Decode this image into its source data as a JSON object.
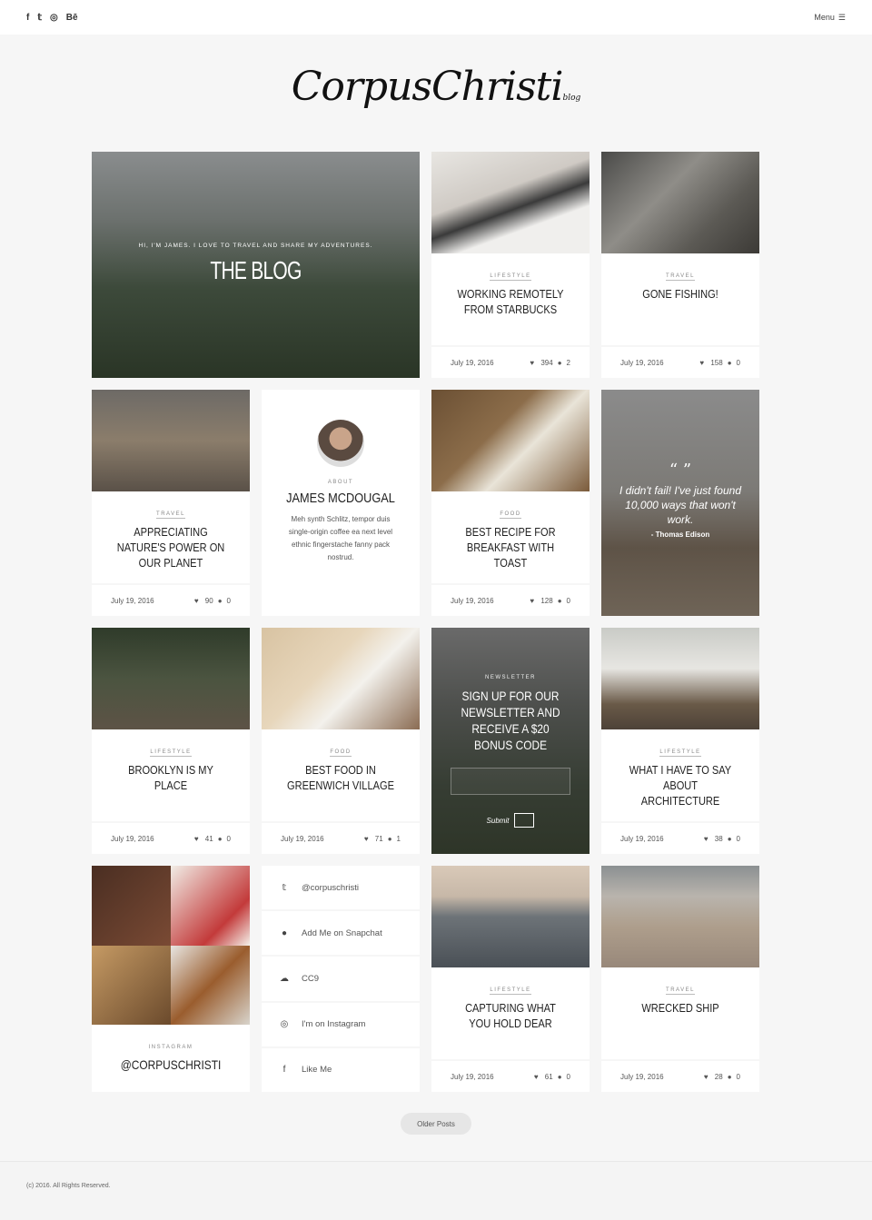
{
  "topbar": {
    "socials": [
      "f",
      "𝕥",
      "◎",
      "Bē"
    ],
    "menu_label": "Menu"
  },
  "logo": {
    "text": "CorpusChristi",
    "sub": "blog"
  },
  "hero": {
    "subtitle": "HI, I'M JAMES. I LOVE TO TRAVEL AND SHARE MY ADVENTURES.",
    "title": "THE BLOG"
  },
  "posts": [
    {
      "category": "LIFESTYLE",
      "title": "WORKING REMOTELY FROM STARBUCKS",
      "date": "July 19, 2016",
      "likes": "394",
      "comments": "2",
      "img": "linear-gradient(160deg,#e8e6e2 0%,#cfcac4 40%,#3a3a3a 55%,#f0efed 70%)"
    },
    {
      "category": "TRAVEL",
      "title": "GONE FISHING!",
      "date": "July 19, 2016",
      "likes": "158",
      "comments": "0",
      "img": "linear-gradient(135deg,#4a4a48 0%,#8f8d88 40%,#5c5a55 70%,#3c3a36 100%)"
    },
    {
      "category": "TRAVEL",
      "title": "APPRECIATING NATURE'S POWER ON OUR PLANET",
      "date": "July 19, 2016",
      "likes": "90",
      "comments": "0",
      "img": "linear-gradient(180deg,#6d6a66 0%,#8b7d6b 50%,#5a5148 100%)"
    },
    {
      "category": "FOOD",
      "title": "BEST RECIPE FOR BREAKFAST WITH TOAST",
      "date": "July 19, 2016",
      "likes": "128",
      "comments": "0",
      "img": "linear-gradient(135deg,#6b5034 0%,#8c6d4a 40%,#e9e4d8 60%,#7a5a3a 100%)"
    },
    {
      "category": "LIFESTYLE",
      "title": "BROOKLYN IS MY PLACE",
      "date": "July 19, 2016",
      "likes": "41",
      "comments": "0",
      "img": "linear-gradient(180deg,#2f3b2a 0%,#4b5440 50%,#5d5346 100%)"
    },
    {
      "category": "FOOD",
      "title": "BEST FOOD IN GREENWICH VILLAGE",
      "date": "July 19, 2016",
      "likes": "71",
      "comments": "1",
      "img": "linear-gradient(135deg,#d8c3a2 0%,#e7d6bb 40%,#f3f1ec 60%,#8a6b52 100%)"
    },
    {
      "category": "LIFESTYLE",
      "title": "WHAT I HAVE TO SAY ABOUT ARCHITECTURE",
      "date": "July 19, 2016",
      "likes": "38",
      "comments": "0",
      "img": "linear-gradient(180deg,#c9cbc6 0%,#e7e6e2 40%,#6a5a48 75%,#4d4238 100%)"
    },
    {
      "category": "LIFESTYLE",
      "title": "CAPTURING WHAT YOU HOLD DEAR",
      "date": "July 19, 2016",
      "likes": "61",
      "comments": "0",
      "img": "linear-gradient(180deg,#d9c9b8 0%,#c7b8a8 30%,#6d7378 50%,#4a5056 100%)"
    },
    {
      "category": "TRAVEL",
      "title": "WRECKED SHIP",
      "date": "July 19, 2016",
      "likes": "28",
      "comments": "0",
      "img": "linear-gradient(180deg,#8b9092 0%,#b9b4ad 30%,#ae9e8c 60%,#98887a 100%)"
    }
  ],
  "about": {
    "category": "ABOUT",
    "name": "JAMES MCDOUGAL",
    "text": "Meh synth Schlitz, tempor duis single-origin coffee ea next level ethnic fingerstache fanny pack nostrud."
  },
  "quote": {
    "marks": "“ ”",
    "text": "I didn't fail! I've just found 10,000 ways that won't work.",
    "author": "- Thomas Edison"
  },
  "newsletter": {
    "category": "NEWSLETTER",
    "title": "SIGN UP FOR OUR NEWSLETTER AND RECEIVE A $20 BONUS CODE",
    "input_value": "",
    "submit_label": "Submit"
  },
  "instagram": {
    "category": "INSTAGRAM",
    "handle": "@CORPUSCHRISTI"
  },
  "links": [
    {
      "icon": "twitter-icon",
      "glyph": "𝕥",
      "label": "@corpuschristi"
    },
    {
      "icon": "snapchat-icon",
      "glyph": "●",
      "label": "Add Me on Snapchat"
    },
    {
      "icon": "soundcloud-icon",
      "glyph": "☁",
      "label": "CC9"
    },
    {
      "icon": "instagram-icon",
      "glyph": "◎",
      "label": "I'm on Instagram"
    },
    {
      "icon": "facebook-icon",
      "glyph": "f",
      "label": "Like Me"
    }
  ],
  "older_posts": "Older Posts",
  "footer": {
    "copyright": "(c) 2016. All Rights Reserved."
  }
}
